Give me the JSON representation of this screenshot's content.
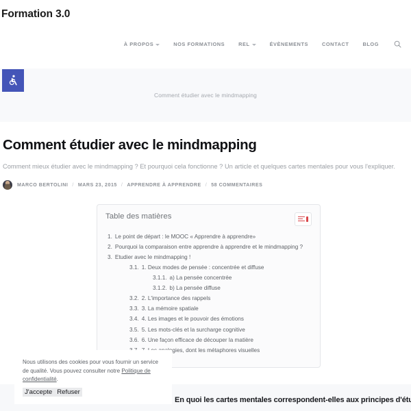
{
  "site": {
    "title": "Formation 3.0"
  },
  "accessibility": {
    "icon": "wheelchair-accessibility-icon",
    "color": "#4455b8"
  },
  "nav": {
    "items": [
      {
        "label": "À PROPOS",
        "has_dropdown": true
      },
      {
        "label": "NOS FORMATIONS",
        "has_dropdown": false
      },
      {
        "label": "REL",
        "has_dropdown": true
      },
      {
        "label": "ÉVÈNEMENTS",
        "has_dropdown": false
      },
      {
        "label": "CONTACT",
        "has_dropdown": false
      },
      {
        "label": "BLOG",
        "has_dropdown": false
      }
    ],
    "search_icon": "search-icon"
  },
  "breadcrumb": {
    "current": "Comment étudier avec le mindmapping"
  },
  "post": {
    "title": "Comment étudier avec le mindmapping",
    "excerpt": "Comment mieux étudier avec le mindmapping ? Et pourquoi cela fonctionne ? Un article et quelques cartes mentales pour vous l'expliquer.",
    "meta": {
      "author": "MARCO BERTOLINI",
      "date": "MARS 23, 2015",
      "category": "APPRENDRE À APPRENDRE",
      "comments": "58 COMMENTAIRES",
      "separator": "/"
    }
  },
  "toc": {
    "title": "Table des matières",
    "toggle_icon": "toc-list-toggle-icon",
    "accent_color": "#d9464a",
    "items": [
      {
        "num": "1.",
        "text": "Le point de départ : le MOOC « Apprendre à apprendre»",
        "level": 1
      },
      {
        "num": "2.",
        "text": "Pourquoi la comparaison entre apprendre à apprendre et le mindmapping ?",
        "level": 1
      },
      {
        "num": "3.",
        "text": "Etudier avec le mindmapping !",
        "level": 1
      },
      {
        "num": "3.1.",
        "text": "1. Deux modes de pensée : concentrée et diffuse",
        "level": 2
      },
      {
        "num": "3.1.1.",
        "text": "a) La pensée concentrée",
        "level": 3
      },
      {
        "num": "3.1.2.",
        "text": "b) La pensée diffuse",
        "level": 3
      },
      {
        "num": "3.2.",
        "text": "2. L'importance des rappels",
        "level": 2
      },
      {
        "num": "3.3.",
        "text": "3. La mémoire spatiale",
        "level": 2
      },
      {
        "num": "3.4.",
        "text": "4. Les images et le pouvoir des émotions",
        "level": 2
      },
      {
        "num": "3.5.",
        "text": "5. Les mots-clés et la surcharge cognitive",
        "level": 2
      },
      {
        "num": "3.6.",
        "text": "6. Une façon efficace de découper la matière",
        "level": 2
      },
      {
        "num": "3.7.",
        "text": "7. Les analogies, dont les métaphores visuelles",
        "level": 2
      }
    ]
  },
  "bottom_section": {
    "heading": "En quoi les cartes mentales correspondent-elles aux principes d'étude"
  },
  "cookie_banner": {
    "text_part1": "Nous utilisons des cookies pour vous fournir un service de qualité.  Vous pouvez consulter notre ",
    "link_label": "Politique de confidentialité",
    "text_part2": ".",
    "accept_label": "J'accepte",
    "refuse_label": "Refuser"
  }
}
